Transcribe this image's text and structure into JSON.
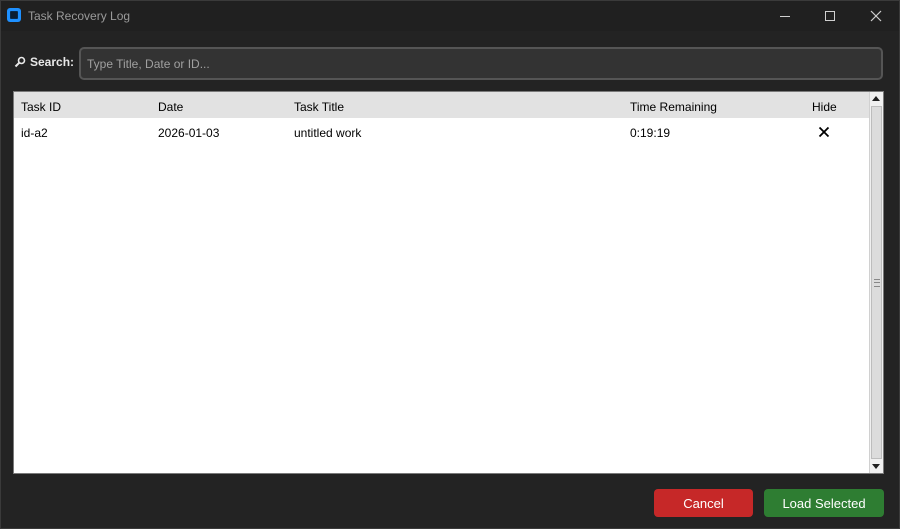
{
  "window": {
    "title": "Task Recovery Log",
    "icon": "app-icon",
    "controls": [
      "minimize-icon",
      "maximize-icon",
      "close-icon"
    ]
  },
  "search": {
    "label": "Search:",
    "icon": "search-icon",
    "placeholder": "Type Title, Date or ID...",
    "value": ""
  },
  "table": {
    "columns": [
      "Task ID",
      "Date",
      "Task Title",
      "Time Remaining",
      "Hide"
    ],
    "rows": [
      {
        "task_id": "id-a2",
        "date": "2026-01-03",
        "title": "untitled work",
        "time_remaining": "0:19:19",
        "hide_icon": "close-x-icon"
      }
    ]
  },
  "buttons": {
    "cancel_label": "Cancel",
    "load_label": "Load Selected"
  },
  "colors": {
    "background": "#232323",
    "cancel": "#c62828",
    "load": "#2e7d32",
    "accent": "#1e90ff"
  }
}
